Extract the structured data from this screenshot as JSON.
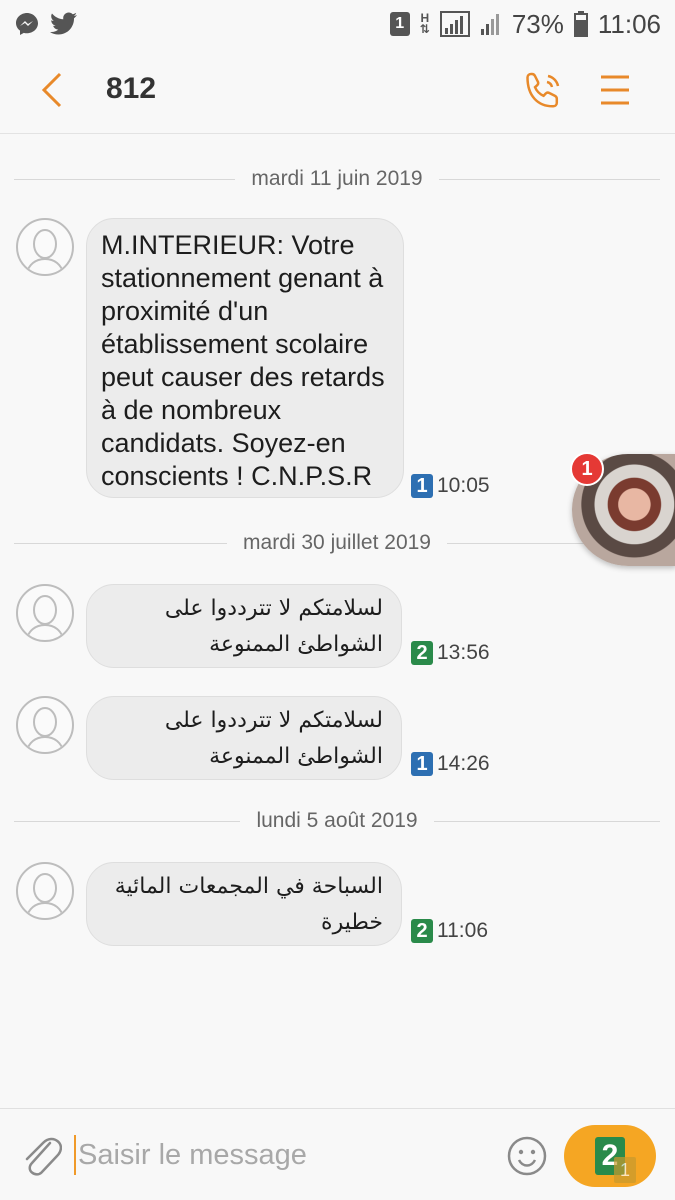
{
  "status_bar": {
    "sim_indicator": "1",
    "network_type": "H",
    "battery_percent": "73%",
    "time": "11:06",
    "left_icons": [
      "messenger-icon",
      "twitter-icon"
    ],
    "colors": {
      "icon": "#555555"
    }
  },
  "header": {
    "title": "812",
    "accent_color": "#e8892a"
  },
  "conversation": {
    "dates": [
      "mardi 11 juin 2019",
      "mardi 30 juillet 2019",
      "lundi 5 août 2019"
    ],
    "messages": [
      {
        "text": "M.INTERIEUR: Votre stationnement genant à proximité d'un établissement scolaire peut causer des retards à de nombreux candidats. Soyez-en conscients ! C.N.P.S.R",
        "sim": "1",
        "time": "10:05"
      },
      {
        "text": "لسلامتكم لا تترددوا على الشواطئ الممنوعة",
        "sim": "2",
        "time": "13:56"
      },
      {
        "text": "لسلامتكم لا تترددوا على الشواطئ الممنوعة",
        "sim": "1",
        "time": "14:26"
      },
      {
        "text": "السباحة في المجمعات المائية خطيرة",
        "sim": "2",
        "time": "11:06"
      }
    ],
    "sim_colors": {
      "sim1": "#2d6fb2",
      "sim2": "#2a8a4a"
    }
  },
  "chat_head": {
    "notification_count": "1"
  },
  "compose": {
    "placeholder": "Saisir le message",
    "send_sim": "2",
    "send_secondary_sim": "1",
    "send_color": "#f5a623"
  }
}
